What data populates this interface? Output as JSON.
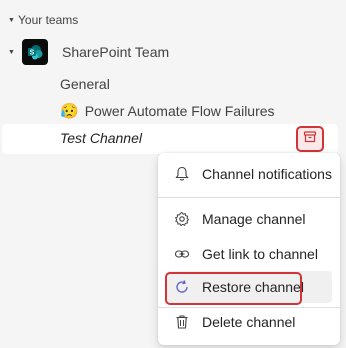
{
  "section": {
    "label": "Your teams"
  },
  "team": {
    "name": "SharePoint Team",
    "logo_icon": "sharepoint-logo-icon"
  },
  "channels": {
    "general": "General",
    "power_automate": {
      "emoji": "😥",
      "label": "Power Automate Flow Failures"
    },
    "test": "Test Channel"
  },
  "archive_button": {
    "icon": "archive-icon"
  },
  "menu": {
    "notifications": "Channel notifications",
    "manage": "Manage channel",
    "get_link": "Get link to channel",
    "restore": "Restore channel",
    "delete": "Delete channel"
  },
  "colors": {
    "highlight": "#d13438",
    "accent": "#5b5fc7"
  }
}
